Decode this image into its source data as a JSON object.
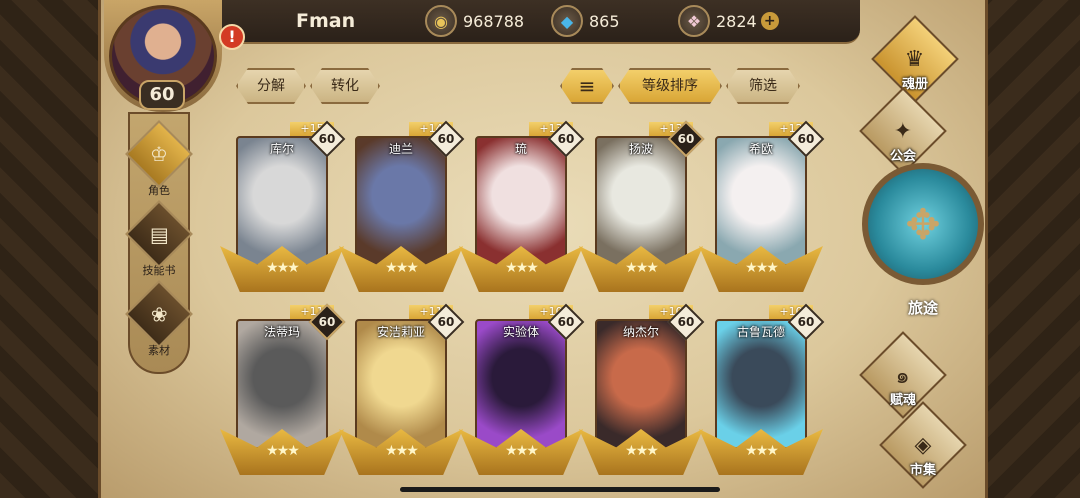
{
  "player": {
    "name": "Fman",
    "level": "60"
  },
  "resources": [
    {
      "icon": "gold-coin-icon",
      "glyph": "◉",
      "value": "968788"
    },
    {
      "icon": "blue-crystal-icon",
      "glyph": "◆",
      "value": "865"
    },
    {
      "icon": "pink-gem-icon",
      "glyph": "❖",
      "value": "2824"
    }
  ],
  "add_glyph": "+",
  "alert_glyph": "!",
  "left_tabs": [
    {
      "label": "角色",
      "glyph": "♔"
    },
    {
      "label": "技能书",
      "glyph": "▤"
    },
    {
      "label": "素材",
      "glyph": "❀"
    }
  ],
  "actions": {
    "decompose": "分解",
    "convert": "转化",
    "sort_icon": "≡",
    "sort_by_level": "等级排序",
    "filter": "筛选"
  },
  "heroes": [
    {
      "name": "库尔",
      "plus": "+15",
      "level": "60",
      "dark": false
    },
    {
      "name": "迪兰",
      "plus": "+14",
      "level": "60",
      "dark": false
    },
    {
      "name": "琉",
      "plus": "+13",
      "level": "60",
      "dark": false
    },
    {
      "name": "扬波",
      "plus": "+13",
      "level": "60",
      "dark": true
    },
    {
      "name": "希欧",
      "plus": "+12",
      "level": "60",
      "dark": false
    },
    {
      "name": "法蒂玛",
      "plus": "+11",
      "level": "60",
      "dark": true
    },
    {
      "name": "安洁莉亚",
      "plus": "+11",
      "level": "60",
      "dark": false
    },
    {
      "name": "实验体",
      "plus": "+10",
      "level": "60",
      "dark": false
    },
    {
      "name": "纳杰尔",
      "plus": "+10",
      "level": "60",
      "dark": false
    },
    {
      "name": "古鲁瓦德",
      "plus": "+10",
      "level": "60",
      "dark": false
    }
  ],
  "hero_stars": "★★★",
  "right_menu": {
    "soul_book": "魂册",
    "guild": "公会",
    "journey": "旅途",
    "soul_gift": "赋魂",
    "market": "市集"
  },
  "right_glyphs": {
    "soul_book": "♛",
    "guild": "✦",
    "journey": "✥",
    "soul_gift": "๑",
    "market": "◈"
  },
  "colors": {
    "accent_gold": "#d9a636",
    "parchment": "#dcc89c",
    "alert_red": "#d33b24"
  }
}
